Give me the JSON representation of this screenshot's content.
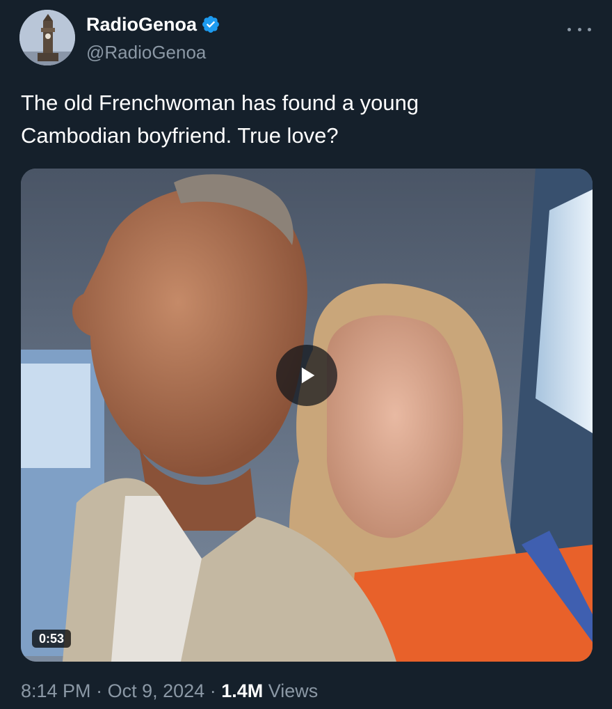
{
  "author": {
    "display_name": "RadioGenoa",
    "handle": "@RadioGenoa",
    "verified": true,
    "avatar_icon": "clock-tower-avatar"
  },
  "tweet": {
    "text_line1": "The old Frenchwoman has found a young",
    "text_line2": "Cambodian boyfriend. True love?"
  },
  "media": {
    "type": "video",
    "duration": "0:53",
    "play_icon": "play-icon"
  },
  "meta": {
    "time": "8:14 PM",
    "date": "Oct 9, 2024",
    "separator": "·",
    "views_count": "1.4M",
    "views_label": "Views"
  },
  "colors": {
    "background": "#15202b",
    "secondary_text": "#8b98a5",
    "verified_badge": "#1d9bf0"
  }
}
